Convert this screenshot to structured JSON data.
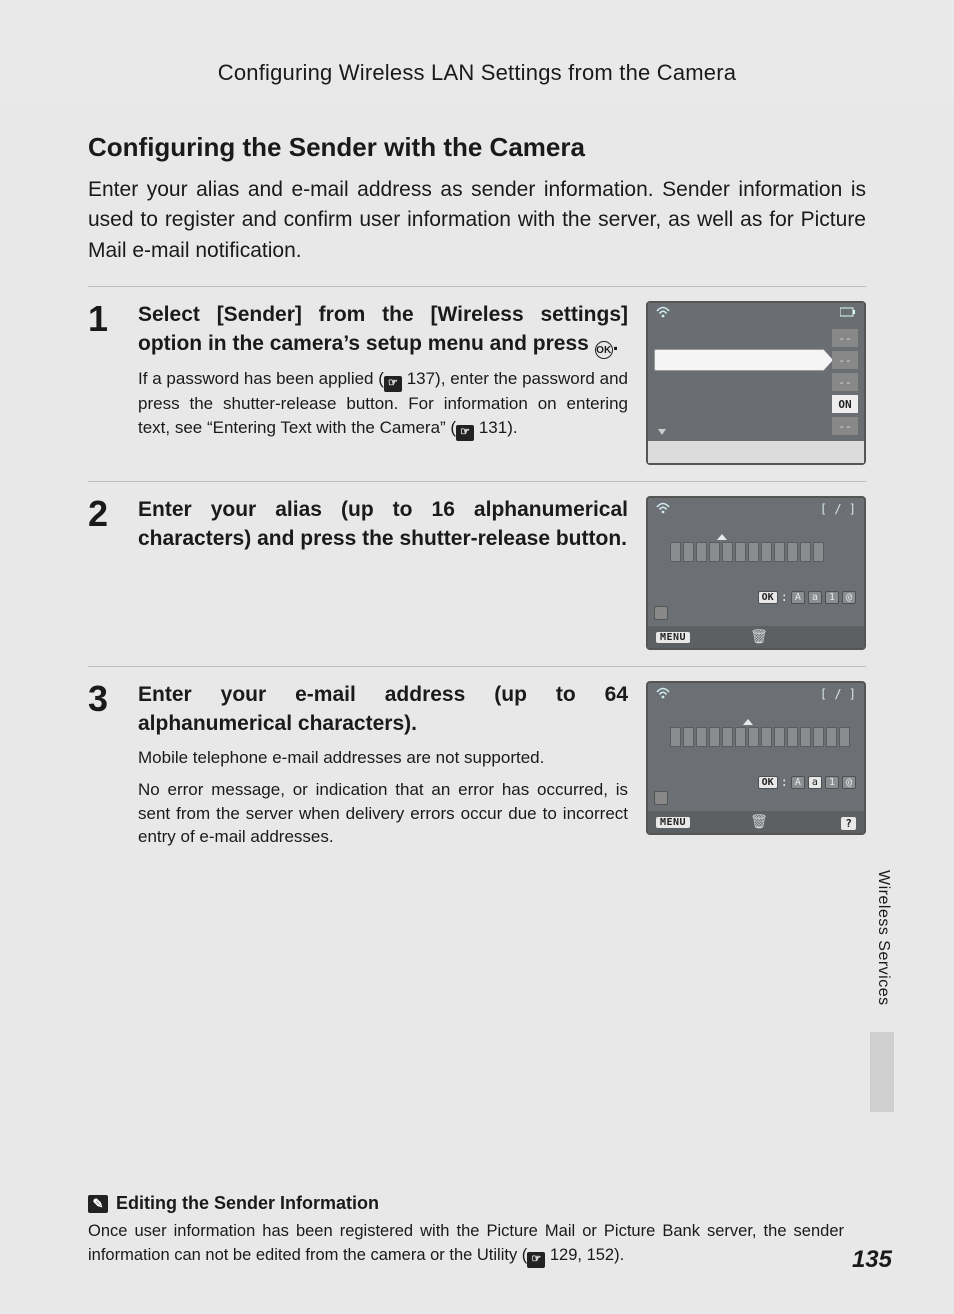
{
  "header": {
    "title": "Configuring Wireless LAN Settings from the Camera"
  },
  "section": {
    "heading": "Configuring the Sender with the Camera",
    "intro": "Enter your alias and e-mail address as sender information. Sender information is used to register and confirm user information with the server, as well as for Picture Mail e-mail notification."
  },
  "steps": [
    {
      "num": "1",
      "title_a": "Select [Sender] from the [Wireless settings] option in the camera’s setup menu and press ",
      "title_b": ".",
      "desc_a": "If a password has been applied (",
      "desc_ref1": " 137), enter the password and press the shutter-release button. For information on entering text, see “Entering Text with the Camera” (",
      "desc_ref2": " 131).",
      "fig": {
        "r1": "--",
        "r2": "--",
        "r3": "--",
        "r4": "ON",
        "r5": "--"
      }
    },
    {
      "num": "2",
      "title": "Enter your alias (up to 16 alphanumerical characters) and press the shutter-release button.",
      "fig": {
        "counter": "[    /    ]",
        "ok": "OK",
        "chips": [
          "A",
          "a",
          "1",
          "@"
        ],
        "menu": "MENU",
        "cells": 12,
        "caret_after": 4
      }
    },
    {
      "num": "3",
      "title": "Enter your e-mail address (up to 64 alphanumerical characters).",
      "desc1": "Mobile telephone e-mail addresses are not supported.",
      "desc2": "No error message, or indication that an error has occurred, is sent from the server when delivery errors occur due to incorrect entry of e-mail addresses.",
      "fig": {
        "counter": "[    /    ]",
        "ok": "OK",
        "chips": [
          "A",
          "a",
          "1",
          "@"
        ],
        "menu": "MENU",
        "help": "?",
        "cells": 14,
        "caret_after": 6
      }
    }
  ],
  "sidetab": "Wireless Services",
  "note": {
    "heading": "Editing the Sender Information",
    "body_a": "Once user information has been registered with the Picture Mail or Picture Bank server, the sender information can not be edited from the camera or the Utility (",
    "body_b": " 129, 152)."
  },
  "pagenum": "135",
  "icons": {
    "ok": "OK",
    "ref": "☞",
    "note": "✎"
  }
}
